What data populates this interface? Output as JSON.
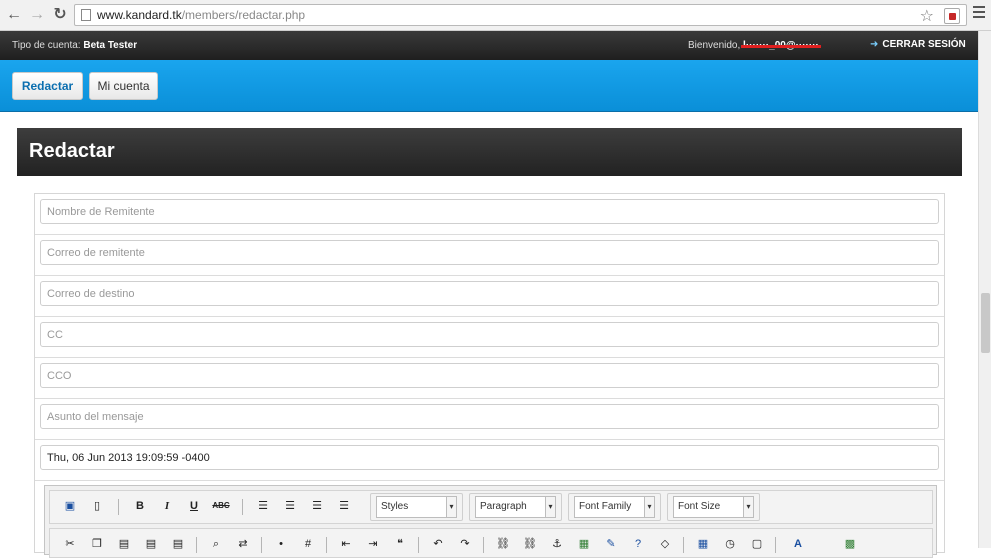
{
  "browser": {
    "url_host": "www.kandard.tk",
    "url_path": "/members/redactar.php"
  },
  "topbar": {
    "account_label": "Tipo de cuenta:",
    "account_type": "Beta Tester",
    "welcome_label": "Bienvenido,",
    "email": "l·······_00@·······",
    "logout_label": "CERRAR SESIÓN"
  },
  "tabs": [
    {
      "label": "Redactar",
      "active": true
    },
    {
      "label": "Mi cuenta",
      "active": false
    }
  ],
  "page": {
    "title": "Redactar"
  },
  "form": {
    "sender_name_placeholder": "Nombre de Remitente",
    "sender_email_placeholder": "Correo de remitente",
    "recipient_placeholder": "Correo de destino",
    "cc_placeholder": "CC",
    "bcc_placeholder": "CCO",
    "subject_placeholder": "Asunto del mensaje",
    "date_value": "Thu, 06 Jun 2013 19:09:59 -0400"
  },
  "editor": {
    "styles_label": "Styles",
    "paragraph_label": "Paragraph",
    "font_family_label": "Font Family",
    "font_size_label": "Font Size",
    "buttons": {
      "bold": "B",
      "italic": "I",
      "underline": "U",
      "strike": "ABC"
    }
  },
  "colors": {
    "tab_bar": "#0a8fd8",
    "header_dark": "#2a2a2a",
    "active_tab_text": "#0b6fb0"
  }
}
